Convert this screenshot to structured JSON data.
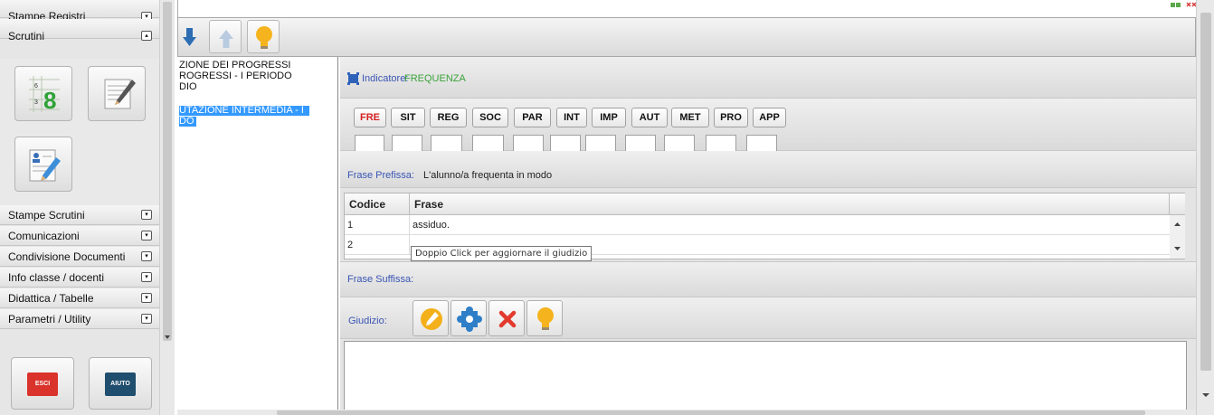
{
  "sidebar": {
    "sections": [
      {
        "label": "Stampe Registri",
        "toggle": "▾"
      },
      {
        "label": "Scrutini",
        "toggle": "▴"
      },
      {
        "label": "Stampe Scrutini",
        "toggle": "▾"
      },
      {
        "label": "Comunicazioni",
        "toggle": "▾"
      },
      {
        "label": "Condivisione Documenti",
        "toggle": "▾"
      },
      {
        "label": "Info classe / docenti",
        "toggle": "▾"
      },
      {
        "label": "Didattica / Tabelle",
        "toggle": "▾"
      },
      {
        "label": "Parametri / Utility",
        "toggle": "▾"
      }
    ],
    "scrutini_tiles": [
      {
        "icon": "grade-grid-icon",
        "text": "8",
        "mini": [
          "6",
          "3"
        ]
      },
      {
        "icon": "notepad-pencil-icon"
      },
      {
        "icon": "student-note-icon"
      }
    ],
    "esci_label": "ESCI",
    "aiuto_label": "AIUTO"
  },
  "toolbar": {
    "buttons": [
      {
        "icon": "arrow-down-icon"
      },
      {
        "icon": "arrow-up-icon"
      },
      {
        "icon": "lightbulb-icon"
      }
    ]
  },
  "tree": {
    "items": [
      "ZIONE DEI PROGRESSI",
      "ROGRESSI - I PERIODO",
      "DIO",
      "UTAZIONE INTERMEDIA - I",
      "DO"
    ],
    "selected": [
      3,
      4
    ]
  },
  "indicator": {
    "label": "Indicatore:",
    "value": "FREQUENZA",
    "icon": "indicator-icon"
  },
  "codes": [
    "FRE",
    "SIT",
    "REG",
    "SOC",
    "PAR",
    "INT",
    "IMP",
    "AUT",
    "MET",
    "PRO",
    "APP"
  ],
  "active_code": "FRE",
  "colors": {
    "active_code": "#d62020",
    "label_blue": "#3a55b4",
    "indicator_green": "#3aa33a",
    "selection": "#3399ff"
  },
  "prefix": {
    "label": "Frase Prefissa:",
    "value": "L'alunno/a frequenta in modo"
  },
  "table": {
    "columns": [
      "Codice",
      "Frase"
    ],
    "rows": [
      {
        "code": "1",
        "text": "assiduo."
      },
      {
        "code": "2",
        "text": ""
      }
    ]
  },
  "tooltip": "Doppio Click per aggiornare il giudizio",
  "suffix": {
    "label": "Frase Suffissa:",
    "value": ""
  },
  "giudizio": {
    "label": "Giudizio:",
    "buttons": [
      {
        "icon": "edit-pencil-icon"
      },
      {
        "icon": "puzzle-icon"
      },
      {
        "icon": "delete-x-icon"
      },
      {
        "icon": "lightbulb-icon"
      }
    ],
    "text": ""
  }
}
